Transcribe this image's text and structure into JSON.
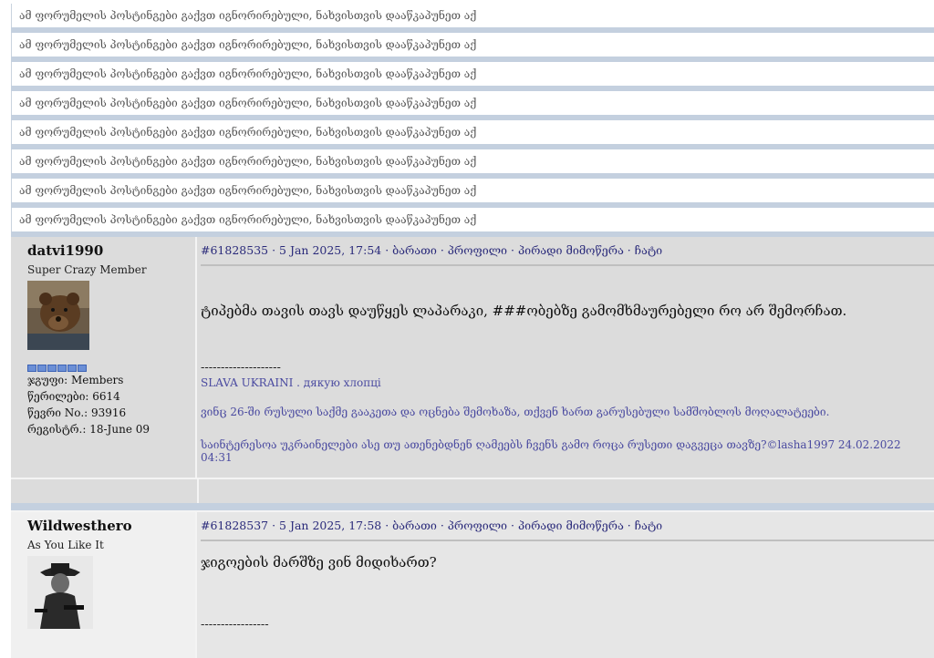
{
  "ignored_notice": "ამ ფორუმელის პოსტინგები გაქვთ იგნორირებული, ნახვისთვის დააწკაპუნეთ აქ",
  "ignored_count_rows": [
    1,
    2,
    3,
    4,
    5,
    6,
    7,
    8
  ],
  "posts": [
    {
      "username": "datvi1990",
      "user_title": "Super Crazy Member",
      "avatar": "bear-avatar",
      "group_label": "ჯგუფი: Members",
      "posts_label": "წერილები: 6614",
      "member_no_label": "წევრი No.: 93916",
      "registered_label": "რეგისტრ.: 18-June 09",
      "post_id": "#61828535",
      "date": " · 5 Jan 2025, 17:54 · ",
      "link_report": "ბარათი",
      "link_profile": "პროფილი",
      "link_pm": "პირადი მიმოწერა",
      "link_chat": "ჩატი",
      "sep": " · ",
      "body": "ტიპებმა თავის თავს დაუწყეს ლაპარაკი, ###ობებზე გამომხმაურებელი რო არ შემორჩათ.",
      "sig_line": "--------------------",
      "sig1": "SLAVA UKRAINI . дякую хлопці",
      "sig2": "ვინც 26-ში რუსული საქმე გააკეთა და ოცნება შემოხაზა, თქვენ ხართ გარუსებული სამშობლოს მოღალატეები.",
      "sig3": "საინტერესოა უკრაინელები ასე თუ ათენებდნენ ღამეებს ჩვენს გამო როცა რუსეთი დაგვეცა თავზე?©lasha1997 24.02.2022 04:31"
    },
    {
      "username": "Wildwesthero",
      "user_title": "As You Like It",
      "avatar": "cowboy-avatar",
      "post_id": "#61828537",
      "date": " · 5 Jan 2025, 17:58 · ",
      "link_report": "ბარათი",
      "link_profile": "პროფილი",
      "link_pm": "პირადი მიმოწერა",
      "link_chat": "ჩატი",
      "sep": " · ",
      "body": "ჯიგოების მარშზე ვინ მიდიხართ?",
      "sig_line": "-----------------"
    }
  ]
}
